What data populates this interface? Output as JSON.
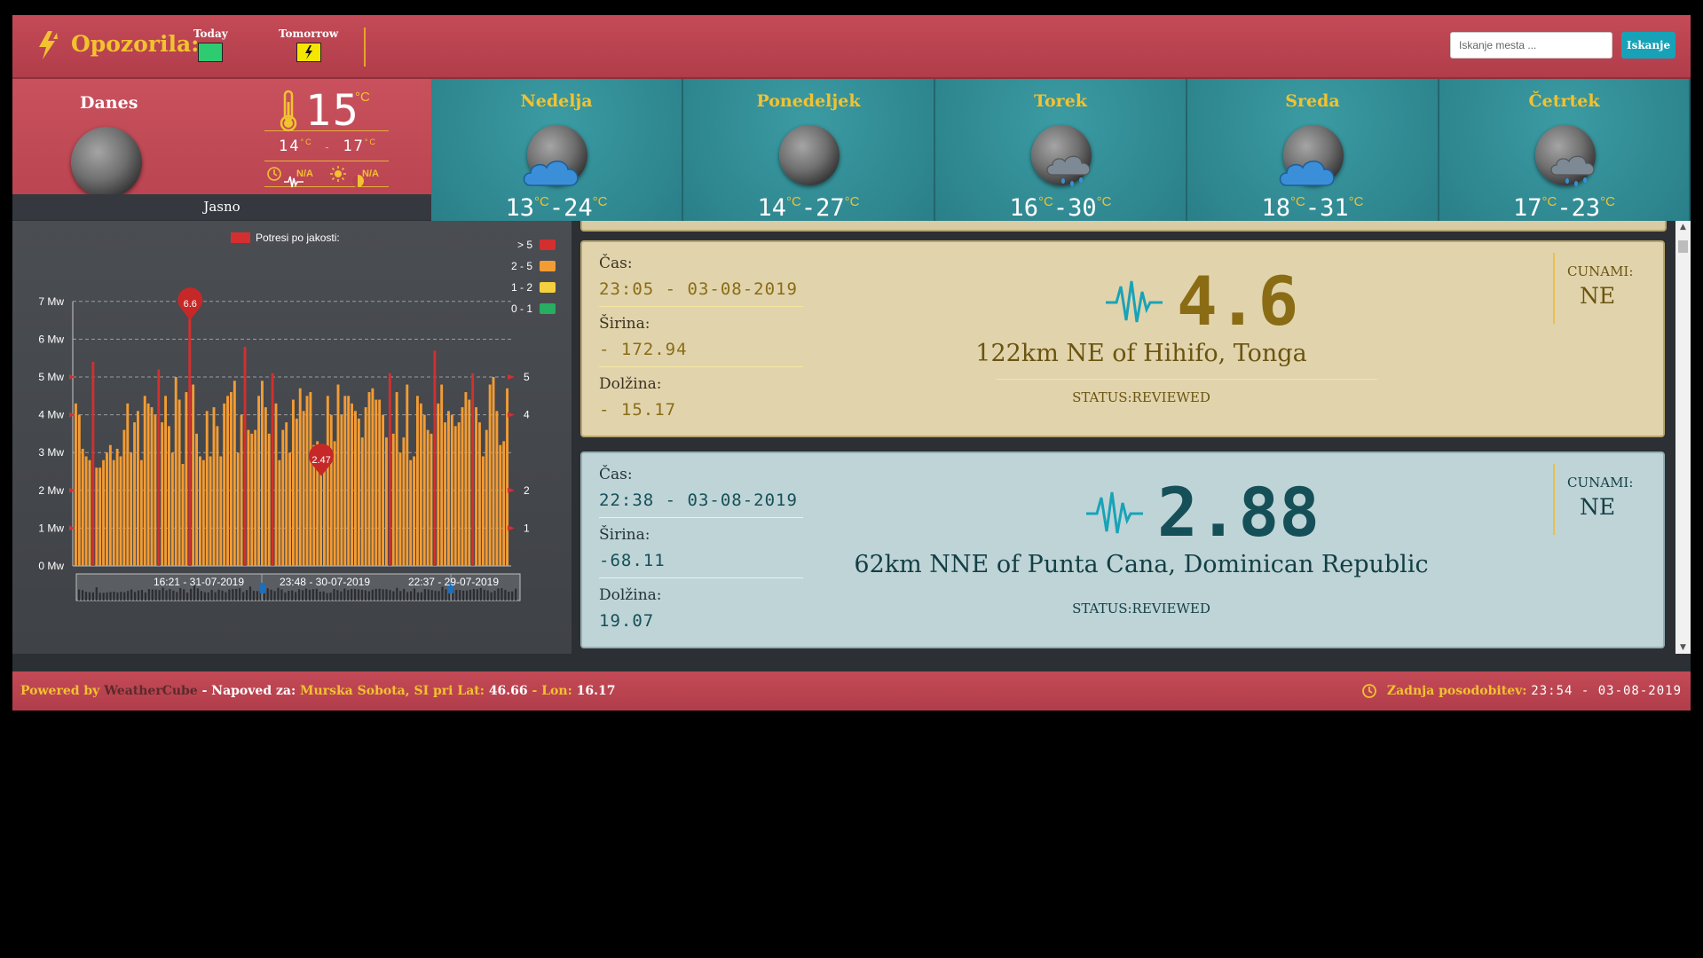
{
  "header": {
    "title": "Opozorila:",
    "alerts": [
      {
        "label": "Today",
        "color": "#2ecc71"
      },
      {
        "label": "Tomorrow",
        "color": "#f5e600"
      }
    ],
    "search_placeholder": "Iskanje mesta ...",
    "search_button": "Iskanje"
  },
  "today": {
    "label": "Danes",
    "temp": "15",
    "unit": "°C",
    "min": "14",
    "max": "17",
    "sunrise": "N/A",
    "sunset": "N/A",
    "condition": "Jasno"
  },
  "forecast": [
    {
      "day": "Nedelja",
      "min": "13",
      "max": "24",
      "icon": "cloud-moon-icon"
    },
    {
      "day": "Ponedeljek",
      "min": "14",
      "max": "27",
      "icon": "moon-icon"
    },
    {
      "day": "Torek",
      "min": "16",
      "max": "30",
      "icon": "rain-moon-icon"
    },
    {
      "day": "Sreda",
      "min": "18",
      "max": "31",
      "icon": "cloud-moon-icon"
    },
    {
      "day": "Četrtek",
      "min": "17",
      "max": "23",
      "icon": "rain-moon-icon"
    }
  ],
  "chart_data": {
    "type": "bar",
    "title": "Potresi po jakosti:",
    "ylabel": "",
    "ylim": [
      0,
      7
    ],
    "y_ticks": [
      "0 Mw",
      "1 Mw",
      "2 Mw",
      "3 Mw",
      "4 Mw",
      "5 Mw",
      "6 Mw",
      "7 Mw"
    ],
    "right_ticks": [
      "1",
      "2",
      "4",
      "5"
    ],
    "legend": [
      {
        "label": "> 5",
        "color": "#d32f2f"
      },
      {
        "label": "2 - 5",
        "color": "#f39c34"
      },
      {
        "label": "1 - 2",
        "color": "#f4d03f"
      },
      {
        "label": "0 - 1",
        "color": "#27ae60"
      }
    ],
    "navigator_labels": [
      "16:21 - 31-07-2019",
      "23:48 - 30-07-2019",
      "22:37 - 29-07-2019"
    ],
    "annotations": [
      {
        "label": "6.6"
      },
      {
        "label": "2.47"
      }
    ],
    "values": [
      4.3,
      4.0,
      3.1,
      2.9,
      2.8,
      5.4,
      2.6,
      2.6,
      2.8,
      3.0,
      3.2,
      2.8,
      3.1,
      2.9,
      3.6,
      4.3,
      3.0,
      3.8,
      4.1,
      2.8,
      4.5,
      4.3,
      4.2,
      4.0,
      5.2,
      3.8,
      4.5,
      3.7,
      3.0,
      5.0,
      4.4,
      2.7,
      4.6,
      6.6,
      4.8,
      3.5,
      2.9,
      2.8,
      4.1,
      2.9,
      4.2,
      3.7,
      2.9,
      4.3,
      4.5,
      4.6,
      4.9,
      3.0,
      4.0,
      5.8,
      3.6,
      3.5,
      3.6,
      4.5,
      4.9,
      4.2,
      3.5,
      5.1,
      4.3,
      2.8,
      3.6,
      3.8,
      3.0,
      4.4,
      3.9,
      4.7,
      4.1,
      4.5,
      4.6,
      3.2,
      3.3,
      2.47,
      2.7,
      4.5,
      4.0,
      3.3,
      4.8,
      4.0,
      4.5,
      4.5,
      4.3,
      4.1,
      3.9,
      3.4,
      4.2,
      4.6,
      4.7,
      4.4,
      4.4,
      4.0,
      3.4,
      5.1,
      3.5,
      4.6,
      3.0,
      3.4,
      4.8,
      2.8,
      2.9,
      4.5,
      4.3,
      4.0,
      3.6,
      3.5,
      5.7,
      4.3,
      4.8,
      3.8,
      4.1,
      4.0,
      3.7,
      3.8,
      4.2,
      4.6,
      4.4,
      5.1,
      4.2,
      3.8,
      2.9,
      3.6,
      4.8,
      5.0,
      4.1,
      3.2,
      3.3,
      4.7
    ]
  },
  "quakes": [
    {
      "time_label": "Čas:",
      "time": "23:05 - 03-08-2019",
      "lat_label": "Širina:",
      "lat": "- 172.94",
      "lon_label": "Dolžina:",
      "lon": "- 15.17",
      "magnitude": "4.6",
      "place": "122km NE of Hihifo, Tonga",
      "status": "STATUS:REVIEWED",
      "tsunami_label": "CUNAMI:",
      "tsunami": "NE"
    },
    {
      "time_label": "Čas:",
      "time": "22:38 - 03-08-2019",
      "lat_label": "Širina:",
      "lat": "-68.11",
      "lon_label": "Dolžina:",
      "lon": "19.07",
      "magnitude": "2.88",
      "place": "62km NNE of Punta Cana, Dominican Republic",
      "status": "STATUS:REVIEWED",
      "tsunami_label": "CUNAMI:",
      "tsunami": "NE"
    }
  ],
  "footer": {
    "powered": "Powered by",
    "brand": "WeatherCube",
    "forecast_for": "- Napoved za:",
    "location": "Murska Sobota, SI pri Lat:",
    "lat": "46.66",
    "lon_label": "- Lon:",
    "lon": "16.17",
    "updated_label": "Zadnja posodobitev:",
    "updated": "23:54 - 03-08-2019"
  }
}
